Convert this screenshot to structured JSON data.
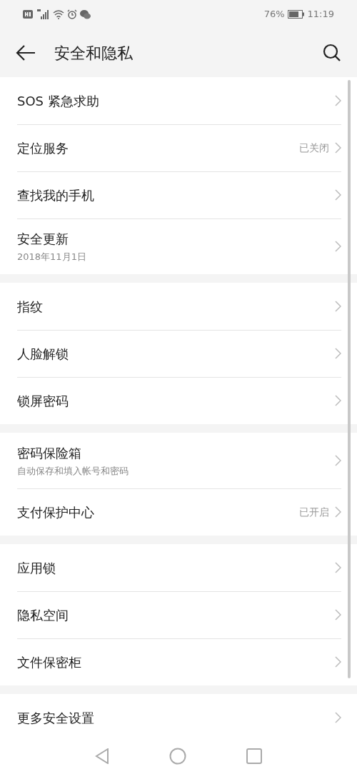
{
  "status_bar": {
    "battery_percent": "76%",
    "time": "11:19"
  },
  "header": {
    "title": "安全和隐私"
  },
  "groups": [
    [
      {
        "title": "SOS 紧急求助"
      },
      {
        "title": "定位服务",
        "value": "已关闭"
      },
      {
        "title": "查找我的手机"
      },
      {
        "title": "安全更新",
        "subtitle": "2018年11月1日"
      }
    ],
    [
      {
        "title": "指纹"
      },
      {
        "title": "人脸解锁"
      },
      {
        "title": "锁屏密码"
      }
    ],
    [
      {
        "title": "密码保险箱",
        "subtitle": "自动保存和填入帐号和密码"
      },
      {
        "title": "支付保护中心",
        "value": "已开启"
      }
    ],
    [
      {
        "title": "应用锁"
      },
      {
        "title": "隐私空间"
      },
      {
        "title": "文件保密柜"
      }
    ],
    [
      {
        "title": "更多安全设置"
      }
    ]
  ]
}
